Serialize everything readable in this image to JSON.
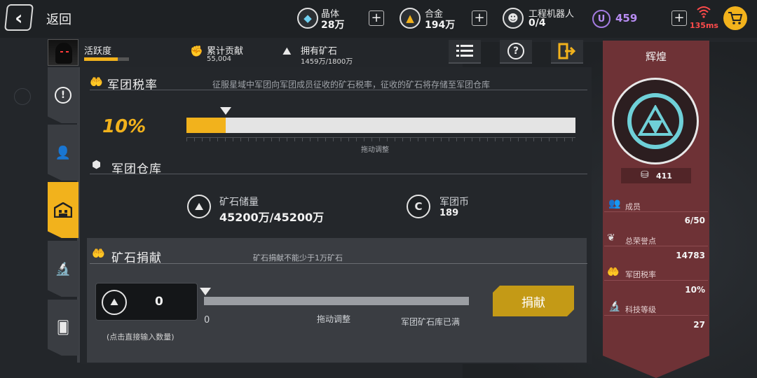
{
  "topbar": {
    "back_label": "返回",
    "resources": [
      {
        "icon": "crystal-icon",
        "name": "晶体",
        "value": "28万",
        "color": "#6fd0f0"
      },
      {
        "icon": "alloy-icon",
        "name": "合金",
        "value": "194万",
        "color": "#f2b21c"
      },
      {
        "icon": "robot-icon",
        "name": "工程机器人",
        "value": "0/4",
        "color": "#e8e8e8"
      }
    ],
    "u_currency": {
      "symbol": "U",
      "value": "459",
      "color": "#b78cf2"
    },
    "ping": "135ms"
  },
  "header": {
    "activity_label": "活跃度",
    "activity_level": 0.75,
    "contribution_label": "累计贡献",
    "contribution_value": "55,004",
    "ore_label": "拥有矿石",
    "ore_value": "1459万/1800万"
  },
  "tax": {
    "title": "军团税率",
    "description": "征服星域中军团向军团成员征收的矿石税率，征收的矿石将存储至军团仓库",
    "percent_label": "10%",
    "value": 0.1,
    "drag_hint": "拖动调整"
  },
  "warehouse": {
    "title": "军团仓库",
    "ore_label": "矿石储量",
    "ore_value": "45200万/45200万",
    "coin_label": "军团币",
    "coin_value": "189"
  },
  "donate": {
    "title": "矿石捐献",
    "description": "矿石捐献不能少于1万矿石",
    "input_value": "0",
    "input_hint": "(点击直接输入数量)",
    "slider_min": "0",
    "drag_hint": "拖动调整",
    "status": "军团矿石库已满",
    "button_label": "捐献"
  },
  "banner": {
    "title": "辉煌",
    "level": "411",
    "stats": [
      {
        "icon": "members-icon",
        "label": "成员",
        "value": "6/50"
      },
      {
        "icon": "honor-icon",
        "label": "总荣誉点",
        "value": "14783"
      },
      {
        "icon": "tax-icon",
        "label": "军团税率",
        "value": "10%"
      },
      {
        "icon": "tech-icon",
        "label": "科技等级",
        "value": "27"
      }
    ]
  },
  "colors": {
    "accent": "#f2b21c",
    "banner": "#6e3236",
    "emblem": "#6fd0d8",
    "ping": "#ff4b4b"
  }
}
